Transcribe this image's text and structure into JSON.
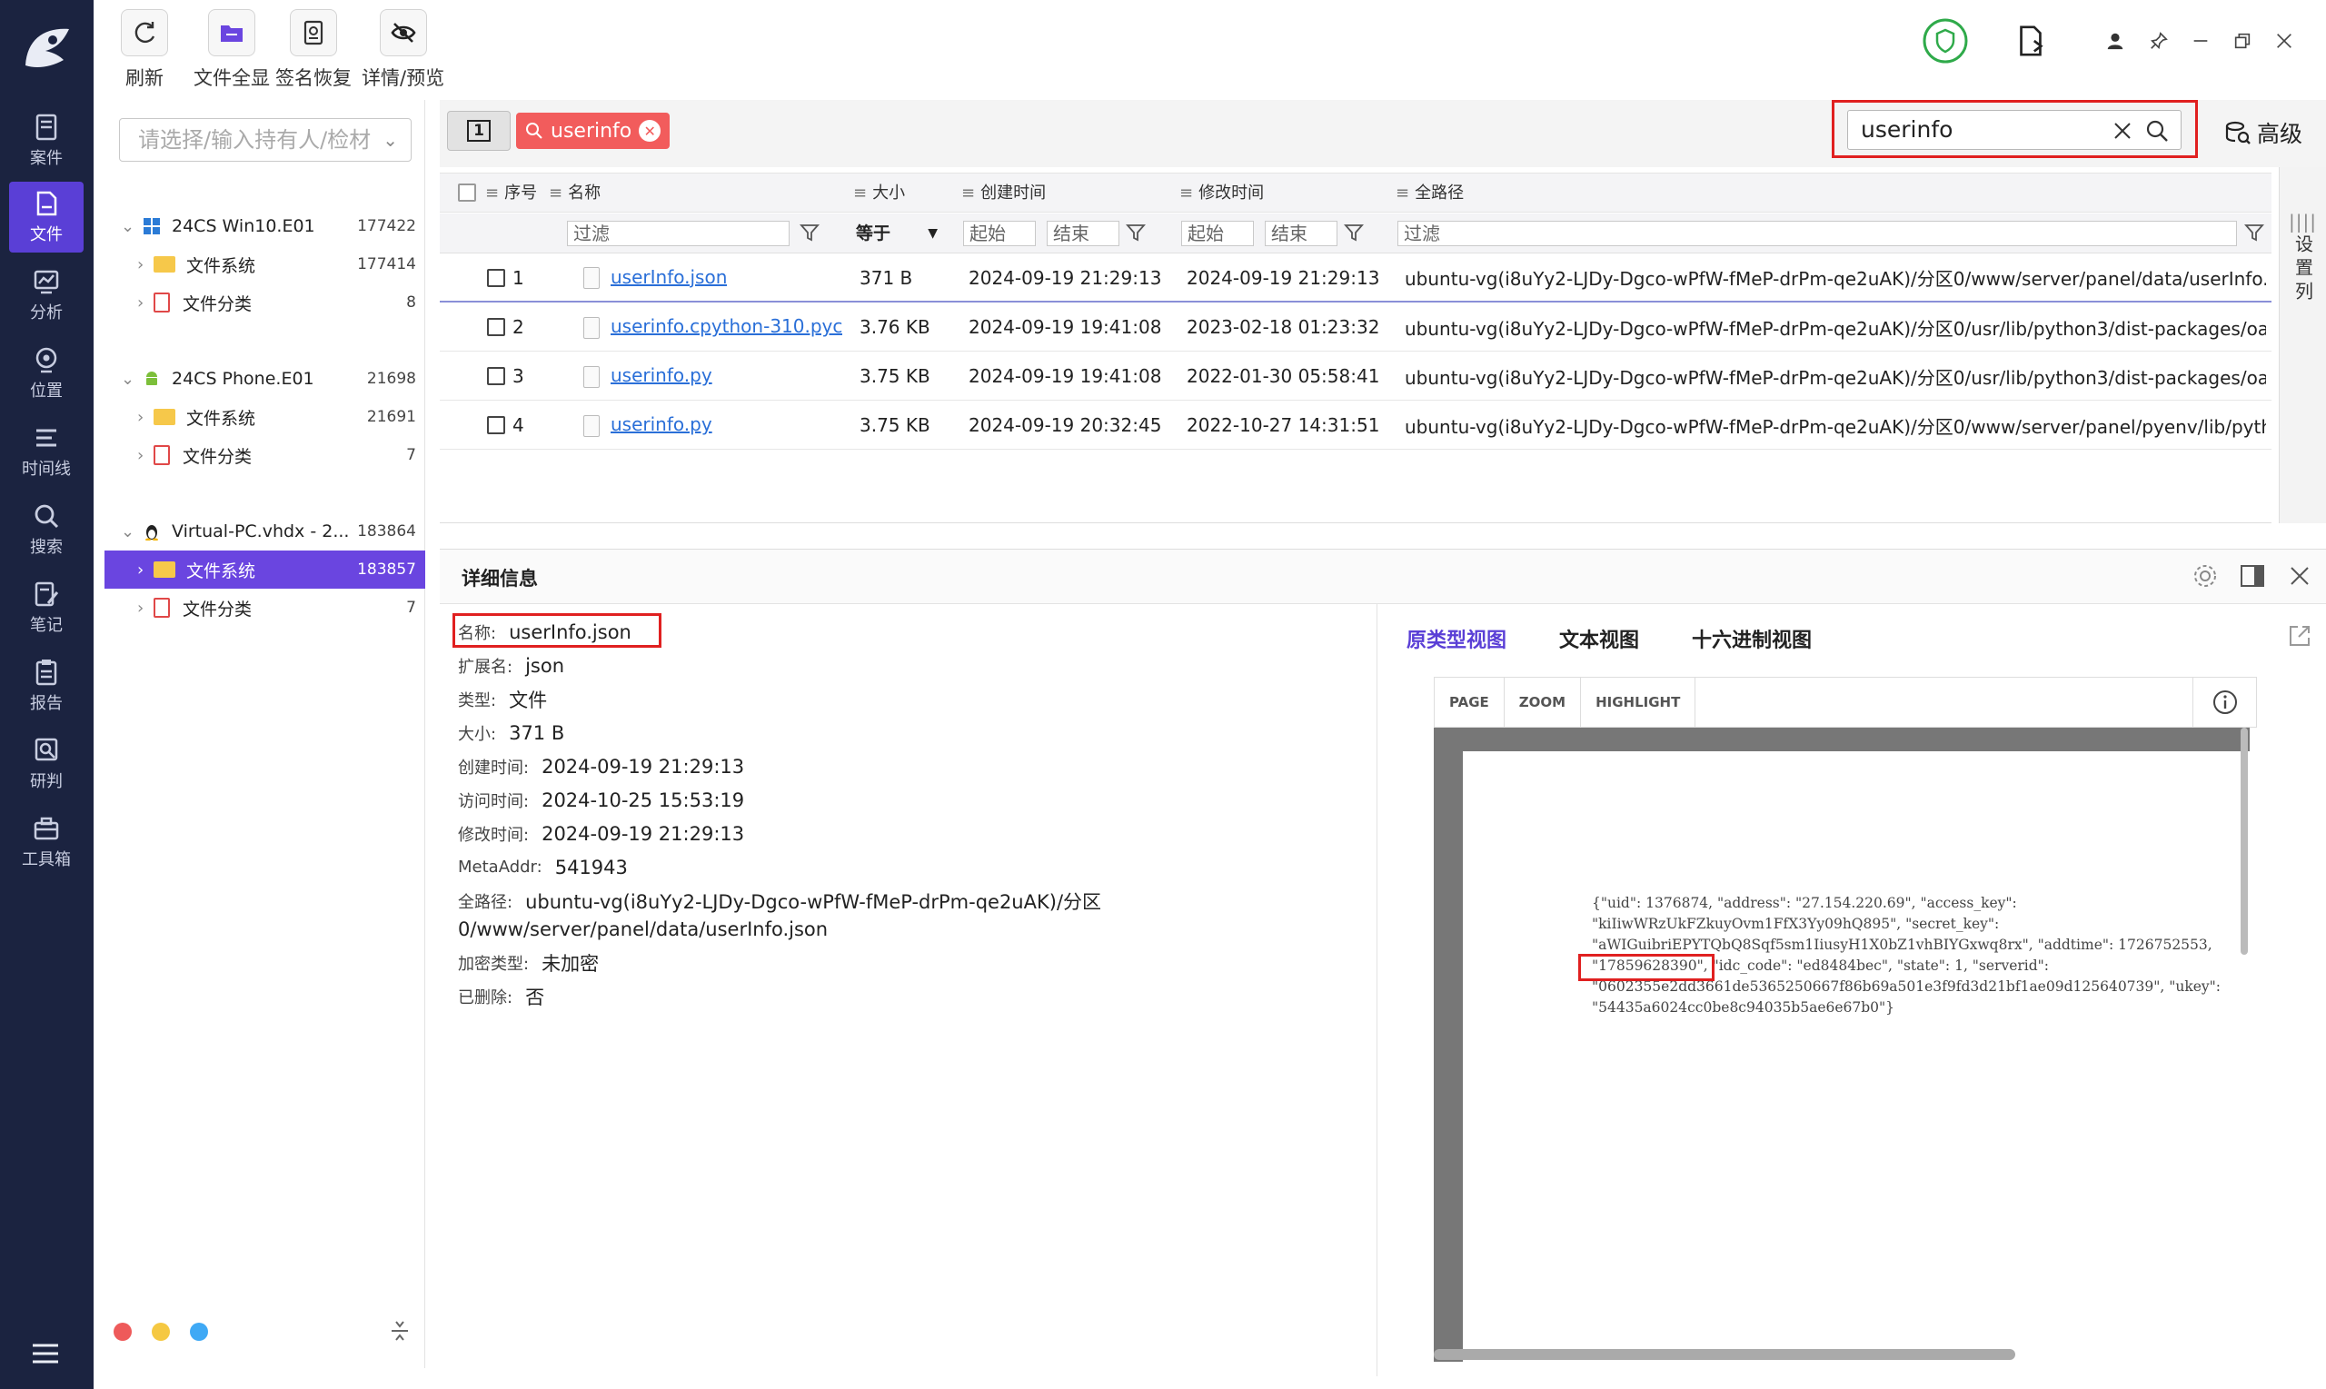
{
  "toolbar": {
    "buttons": [
      {
        "label": "刷新",
        "icon": "refresh-icon"
      },
      {
        "label": "文件全显",
        "icon": "folder-show-icon"
      },
      {
        "label": "签名恢复",
        "icon": "signature-restore-icon"
      },
      {
        "label": "详情/预览",
        "icon": "eye-off-icon"
      }
    ]
  },
  "nav": {
    "items": [
      {
        "label": "案件",
        "icon": "case-icon"
      },
      {
        "label": "文件",
        "icon": "file-icon"
      },
      {
        "label": "分析",
        "icon": "analysis-icon"
      },
      {
        "label": "位置",
        "icon": "location-icon"
      },
      {
        "label": "时间线",
        "icon": "timeline-icon"
      },
      {
        "label": "搜索",
        "icon": "search-icon"
      },
      {
        "label": "笔记",
        "icon": "note-icon"
      },
      {
        "label": "报告",
        "icon": "report-icon"
      },
      {
        "label": "研判",
        "icon": "judge-icon"
      },
      {
        "label": "工具箱",
        "icon": "toolbox-icon"
      }
    ]
  },
  "tree": {
    "owner_placeholder": "请选择/输入持有人/检材",
    "nodes": [
      {
        "label": "24CS Win10.E01",
        "count": "177422"
      },
      {
        "label": "文件系统",
        "count": "177414"
      },
      {
        "label": "文件分类",
        "count": "8"
      },
      {
        "label": "24CS Phone.E01",
        "count": "21698"
      },
      {
        "label": "文件系统",
        "count": "21691"
      },
      {
        "label": "文件分类",
        "count": "7"
      },
      {
        "label": "Virtual-PC.vhdx - 2...",
        "count": "183864"
      },
      {
        "label": "文件系统",
        "count": "183857"
      },
      {
        "label": "文件分类",
        "count": "7"
      }
    ],
    "status_colors": [
      "#ee5a5a",
      "#f5c842",
      "#3fa9f5"
    ]
  },
  "searchbar": {
    "tab_number": "1",
    "chip_label": "userinfo",
    "search_value": "userinfo",
    "advanced_label": "高级"
  },
  "table": {
    "headers": {
      "seq": "序号",
      "name": "名称",
      "size": "大小",
      "created": "创建时间",
      "modified": "修改时间",
      "path": "全路径"
    },
    "filters": {
      "name": "过滤",
      "size_op": "等于",
      "created_start": "起始",
      "created_end": "结束",
      "modified_start": "起始",
      "modified_end": "结束",
      "path": "过滤"
    },
    "side_label": "设置列",
    "rows": [
      {
        "seq": "1",
        "name": "userInfo.json",
        "size": "371 B",
        "created": "2024-09-19 21:29:13",
        "modified": "2024-09-19 21:29:13",
        "path": "ubuntu-vg(i8uYy2-LJDy-Dgco-wPfW-fMeP-drPm-qe2uAK)/分区0/www/server/panel/data/userInfo.j..."
      },
      {
        "seq": "2",
        "name": "userinfo.cpython-310.pyc",
        "size": "3.76 KB",
        "created": "2024-09-19 19:41:08",
        "modified": "2023-02-18 01:23:32",
        "path": "ubuntu-vg(i8uYy2-LJDy-Dgco-wPfW-fMeP-drPm-qe2uAK)/分区0/usr/lib/python3/dist-packages/oa..."
      },
      {
        "seq": "3",
        "name": "userinfo.py",
        "size": "3.75 KB",
        "created": "2024-09-19 19:41:08",
        "modified": "2022-01-30 05:58:41",
        "path": "ubuntu-vg(i8uYy2-LJDy-Dgco-wPfW-fMeP-drPm-qe2uAK)/分区0/usr/lib/python3/dist-packages/oa..."
      },
      {
        "seq": "4",
        "name": "userinfo.py",
        "size": "3.75 KB",
        "created": "2024-09-19 20:32:45",
        "modified": "2022-10-27 14:31:51",
        "path": "ubuntu-vg(i8uYy2-LJDy-Dgco-wPfW-fMeP-drPm-qe2uAK)/分区0/www/server/panel/pyenv/lib/pyth..."
      }
    ]
  },
  "detail": {
    "title": "详细信息",
    "props": [
      {
        "label": "名称:",
        "value": "userInfo.json"
      },
      {
        "label": "扩展名:",
        "value": "json"
      },
      {
        "label": "类型:",
        "value": "文件"
      },
      {
        "label": "大小:",
        "value": "371 B"
      },
      {
        "label": "创建时间:",
        "value": "2024-09-19 21:29:13"
      },
      {
        "label": "访问时间:",
        "value": "2024-10-25 15:53:19"
      },
      {
        "label": "修改时间:",
        "value": "2024-09-19 21:29:13"
      },
      {
        "label": "MetaAddr:",
        "value": "541943"
      },
      {
        "label": "全路径:",
        "value": "ubuntu-vg(i8uYy2-LJDy-Dgco-wPfW-fMeP-drPm-qe2uAK)/分区"
      },
      {
        "label": "",
        "value": "0/www/server/panel/data/userInfo.json"
      },
      {
        "label": "加密类型:",
        "value": "未加密"
      },
      {
        "label": "已删除:",
        "value": "否"
      }
    ],
    "view_tabs": [
      "原类型视图",
      "文本视图",
      "十六进制视图"
    ],
    "pdf_toolbar": [
      "PAGE",
      "ZOOM",
      "HIGHLIGHT"
    ],
    "preview_text": "{\"uid\": 1376874, \"address\": \"27.154.220.69\", \"access_key\":\n\"kiIiwWRzUkFZkuyOvm1FfX3Yy09hQ895\", \"secret_key\":\n\"aWIGuibriEPYTQbQ8Sqf5sm1IiusyH1X0bZ1vhBIYGxwq8rx\", \"addtime\": 1726752553,\n\"17859628390\", \"idc_code\": \"ed8484bec\", \"state\": 1, \"serverid\":\n\"0602355e2dd3661de5365250667f86b69a501e3f9fd3d21bf1ae09d125640739\", \"ukey\":\n\"54435a6024cc0be8c94035b5ae6e67b0\"}"
  },
  "colors": {
    "accent": "#5a3fd6",
    "nav_bg": "#1b2340",
    "highlight_red": "#e02020",
    "chip_red": "#f25c5c",
    "link_blue": "#2a6fd8"
  }
}
